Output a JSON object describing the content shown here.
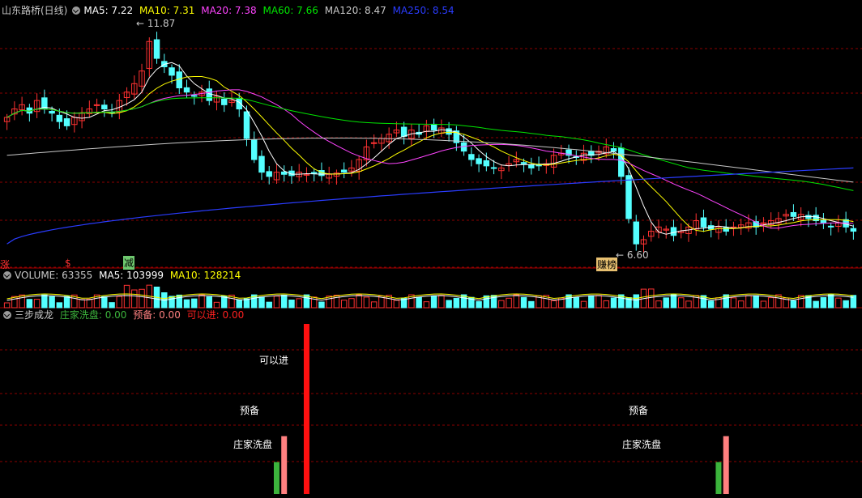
{
  "colors": {
    "up": "#ff3232",
    "down": "#54ffff",
    "ma5": "#ffffff",
    "ma10": "#ffff00",
    "ma20": "#ff44ff",
    "ma60": "#00e600",
    "ma120": "#c8c8c8",
    "ma250": "#2a3cff",
    "grid": "#8b0000",
    "washout": "#3cb43c",
    "prep": "#ff8080",
    "enter": "#ff1010"
  },
  "price_header": {
    "title": "山东路桥(日线)",
    "ma5": "MA5: 7.22",
    "ma10": "MA10: 7.31",
    "ma20": "MA20: 7.38",
    "ma60": "MA60: 7.66",
    "ma120": "MA120: 8.47",
    "ma250": "MA250: 8.54"
  },
  "volume_header": {
    "vol": "VOLUME: 63355",
    "ma5": "MA5: 103999",
    "ma10": "MA10: 128214"
  },
  "indicator_header": {
    "name": "三步成龙",
    "washout": "庄家洗盘: 0.00",
    "prep": "预备: 0.00",
    "enter": "可以进: 0.00"
  },
  "annotations": {
    "high": "11.87",
    "low": "6.60",
    "mark_zhang": "涨",
    "mark_s": "$",
    "mark_jian": "减",
    "mark_bang": "赚榜"
  },
  "signal_labels": {
    "washout": "庄家洗盘",
    "prep": "预备",
    "enter": "可以进"
  },
  "chart_data": [
    {
      "type": "candlestick",
      "title": "山东路桥(日线)",
      "ylim": [
        6.4,
        12.2
      ],
      "series_ma": [
        {
          "name": "MA5",
          "last": 7.22
        },
        {
          "name": "MA10",
          "last": 7.31
        },
        {
          "name": "MA20",
          "last": 7.38
        },
        {
          "name": "MA60",
          "last": 7.66
        },
        {
          "name": "MA120",
          "last": 8.47
        },
        {
          "name": "MA250",
          "last": 8.54
        }
      ],
      "key_points": [
        {
          "label": "high",
          "value": 11.87
        },
        {
          "label": "low",
          "value": 6.6
        }
      ],
      "close": [
        9.8,
        10.0,
        10.1,
        9.9,
        10.2,
        10.0,
        9.9,
        9.7,
        9.6,
        9.8,
        9.9,
        10.0,
        10.1,
        10.0,
        9.9,
        10.2,
        10.4,
        10.6,
        10.9,
        11.6,
        11.2,
        11.0,
        10.8,
        10.5,
        10.4,
        10.3,
        10.4,
        10.2,
        10.3,
        10.1,
        10.2,
        10.0,
        9.3,
        8.8,
        8.5,
        8.4,
        8.5,
        8.45,
        8.42,
        8.5,
        8.45,
        8.48,
        8.42,
        8.45,
        8.48,
        8.5,
        8.6,
        8.8,
        9.1,
        9.2,
        9.3,
        9.4,
        9.5,
        9.35,
        9.5,
        9.4,
        9.6,
        9.5,
        9.55,
        9.4,
        9.2,
        9.0,
        8.8,
        8.7,
        8.65,
        8.6,
        8.6,
        8.7,
        8.8,
        8.7,
        8.6,
        8.65,
        8.7,
        8.9,
        8.95,
        8.9,
        8.85,
        8.95,
        8.9,
        9.0,
        9.1,
        9.0,
        8.4,
        7.4,
        6.8,
        6.9,
        7.1,
        7.2,
        7.15,
        7.0,
        7.1,
        7.2,
        7.35,
        7.2,
        7.15,
        7.2,
        7.1,
        7.2,
        7.25,
        7.3,
        7.2,
        7.3,
        7.35,
        7.4,
        7.5,
        7.45,
        7.5,
        7.4,
        7.35,
        7.3,
        7.2,
        7.3,
        7.2,
        7.1
      ]
    },
    {
      "type": "bar",
      "title": "VOLUME",
      "values_last": {
        "VOLUME": 63355,
        "MA5": 103999,
        "MA10": 128214
      }
    },
    {
      "type": "bar",
      "title": "三步成龙",
      "series": [
        {
          "name": "庄家洗盘",
          "signals": [
            {
              "index": 36,
              "value": 1
            },
            {
              "index": 95,
              "value": 1
            }
          ]
        },
        {
          "name": "预备",
          "signals": [
            {
              "index": 37,
              "value": 2
            },
            {
              "index": 96,
              "value": 2
            }
          ]
        },
        {
          "name": "可以进",
          "signals": [
            {
              "index": 40,
              "value": 4
            }
          ]
        }
      ]
    }
  ]
}
